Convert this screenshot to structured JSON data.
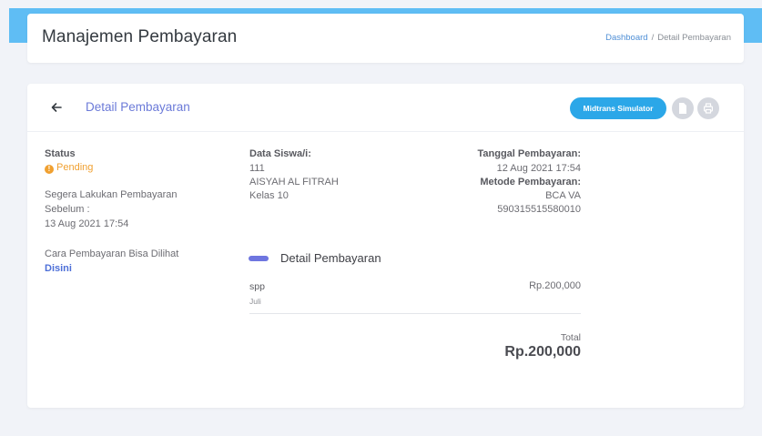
{
  "header": {
    "title": "Manajemen Pembayaran",
    "breadcrumb": {
      "home": "Dashboard",
      "separator": "/",
      "current": "Detail Pembayaran"
    }
  },
  "card": {
    "title": "Detail Pembayaran",
    "back_icon": "arrow-left-icon",
    "buttons": {
      "midtrans": "Midtrans Simulator",
      "doc_icon": "document-icon",
      "print_icon": "printer-icon"
    }
  },
  "status": {
    "label": "Status",
    "value": "Pending",
    "icon": "exclamation-circle-icon",
    "deadline_line1": "Segera Lakukan Pembayaran",
    "deadline_line2": "Sebelum :",
    "deadline_date": "13 Aug 2021 17:54",
    "how_to_text": "Cara Pembayaran Bisa Dilihat",
    "how_to_link": "Disini"
  },
  "student": {
    "label": "Data Siswa/i:",
    "id": "111",
    "name": "AISYAH AL FITRAH",
    "class": "Kelas 10"
  },
  "payment": {
    "date_label": "Tanggal Pembayaran:",
    "date_value": "12 Aug 2021 17:54",
    "method_label": "Metode Pembayaran:",
    "method_value": "BCA VA",
    "va_number": "590315515580010"
  },
  "detail": {
    "heading": "Detail Pembayaran",
    "items": [
      {
        "name": "spp",
        "sub": "Juli",
        "price": "Rp.200,000"
      }
    ],
    "total_label": "Total",
    "total_value": "Rp.200,000"
  },
  "colors": {
    "accent": "#6b7ad8",
    "pending": "#f0a030",
    "midtrans_button": "#2ba7e8",
    "top_strip": "#5fbdf4"
  }
}
